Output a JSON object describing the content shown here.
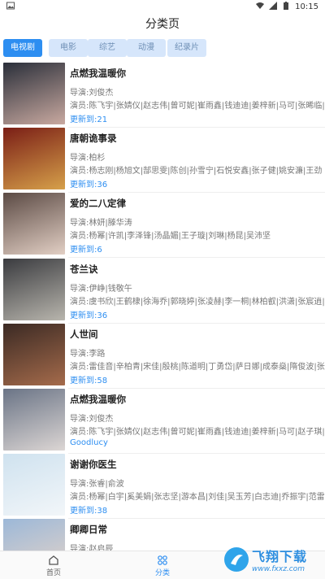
{
  "status_bar": {
    "left_icon": "image-icon",
    "time": "10:15"
  },
  "header": {
    "title": "分类页"
  },
  "tabs": [
    {
      "label": "电视剧",
      "active": true
    },
    {
      "label": "电影",
      "active": false
    },
    {
      "label": "综艺",
      "active": false
    },
    {
      "label": "动漫",
      "active": false
    },
    {
      "label": "纪录片",
      "active": false
    }
  ],
  "items": [
    {
      "title": "点燃我温暖你",
      "director": "导演:刘俊杰",
      "cast": "演员:陈飞宇|张婧仪|赵志伟|曾可妮|崔雨鑫|钱迪迪|姜梓新|马可|张晞临|",
      "update": "更新到:21",
      "colors": [
        "#2a2f3a",
        "#c9a9a0"
      ]
    },
    {
      "title": "唐朝诡事录",
      "director": "导演:柏杉",
      "cast": "演员:杨志刚|杨旭文|郜思雯|陈创|孙雪宁|石悦安鑫|张子健|姚安濂|王劲",
      "update": "更新到:36",
      "colors": [
        "#7a1e16",
        "#d6a04a"
      ]
    },
    {
      "title": "爱的二八定律",
      "director": "导演:林妍|滕华涛",
      "cast": "演员:杨幂|许凯|李泽锋|汤晶媚|王子璇|刘琳|杨昆|吴沛坚",
      "update": "更新到:6",
      "colors": [
        "#5b4a44",
        "#e2cfc4"
      ]
    },
    {
      "title": "苍兰诀",
      "director": "导演:伊峥|钱敬午",
      "cast": "演员:虞书欣|王鹤棣|徐海乔|郭晓婷|张凌赫|李一桐|林柏叡|洪潇|张宸逍|",
      "update": "更新到:36",
      "colors": [
        "#3a3b3f",
        "#b8b5ad"
      ]
    },
    {
      "title": "人世间",
      "director": "导演:李路",
      "cast": "演员:雷佳音|辛柏青|宋佳|殷桃|陈道明|丁勇岱|萨日娜|成泰燊|隋俊波|张",
      "update": "更新到:58",
      "colors": [
        "#3b2a24",
        "#a56b4b"
      ]
    },
    {
      "title": "点燃我温暖你",
      "director": "导演:刘俊杰",
      "cast": "演员:陈飞宇|张婧仪|赵志伟|曾可妮|崔雨鑫|钱迪迪|姜梓新|马可|赵子琪|",
      "update": "Goodlucy",
      "colors": [
        "#6a7486",
        "#dcd6d4"
      ]
    },
    {
      "title": "谢谢你医生",
      "director": "导演:张睿|俞波",
      "cast": "演员:杨幂|白宇|奚美娟|张志坚|游本昌|刘佳|吴玉芳|白志迪|乔振宇|范雷|",
      "update": "更新到:38",
      "colors": [
        "#cfe2ef",
        "#f2f6f9"
      ]
    },
    {
      "title": "卿卿日常",
      "director": "导演:赵启辰",
      "cast": "",
      "update": "",
      "colors": [
        "#9cb8d8",
        "#e8d5c8"
      ]
    }
  ],
  "bottom_nav": [
    {
      "label": "首页",
      "icon": "home-icon",
      "active": false
    },
    {
      "label": "分类",
      "icon": "grid-icon",
      "active": true
    }
  ],
  "watermark": {
    "text": "飞翔下载",
    "sub": "www.fxxz.com"
  }
}
